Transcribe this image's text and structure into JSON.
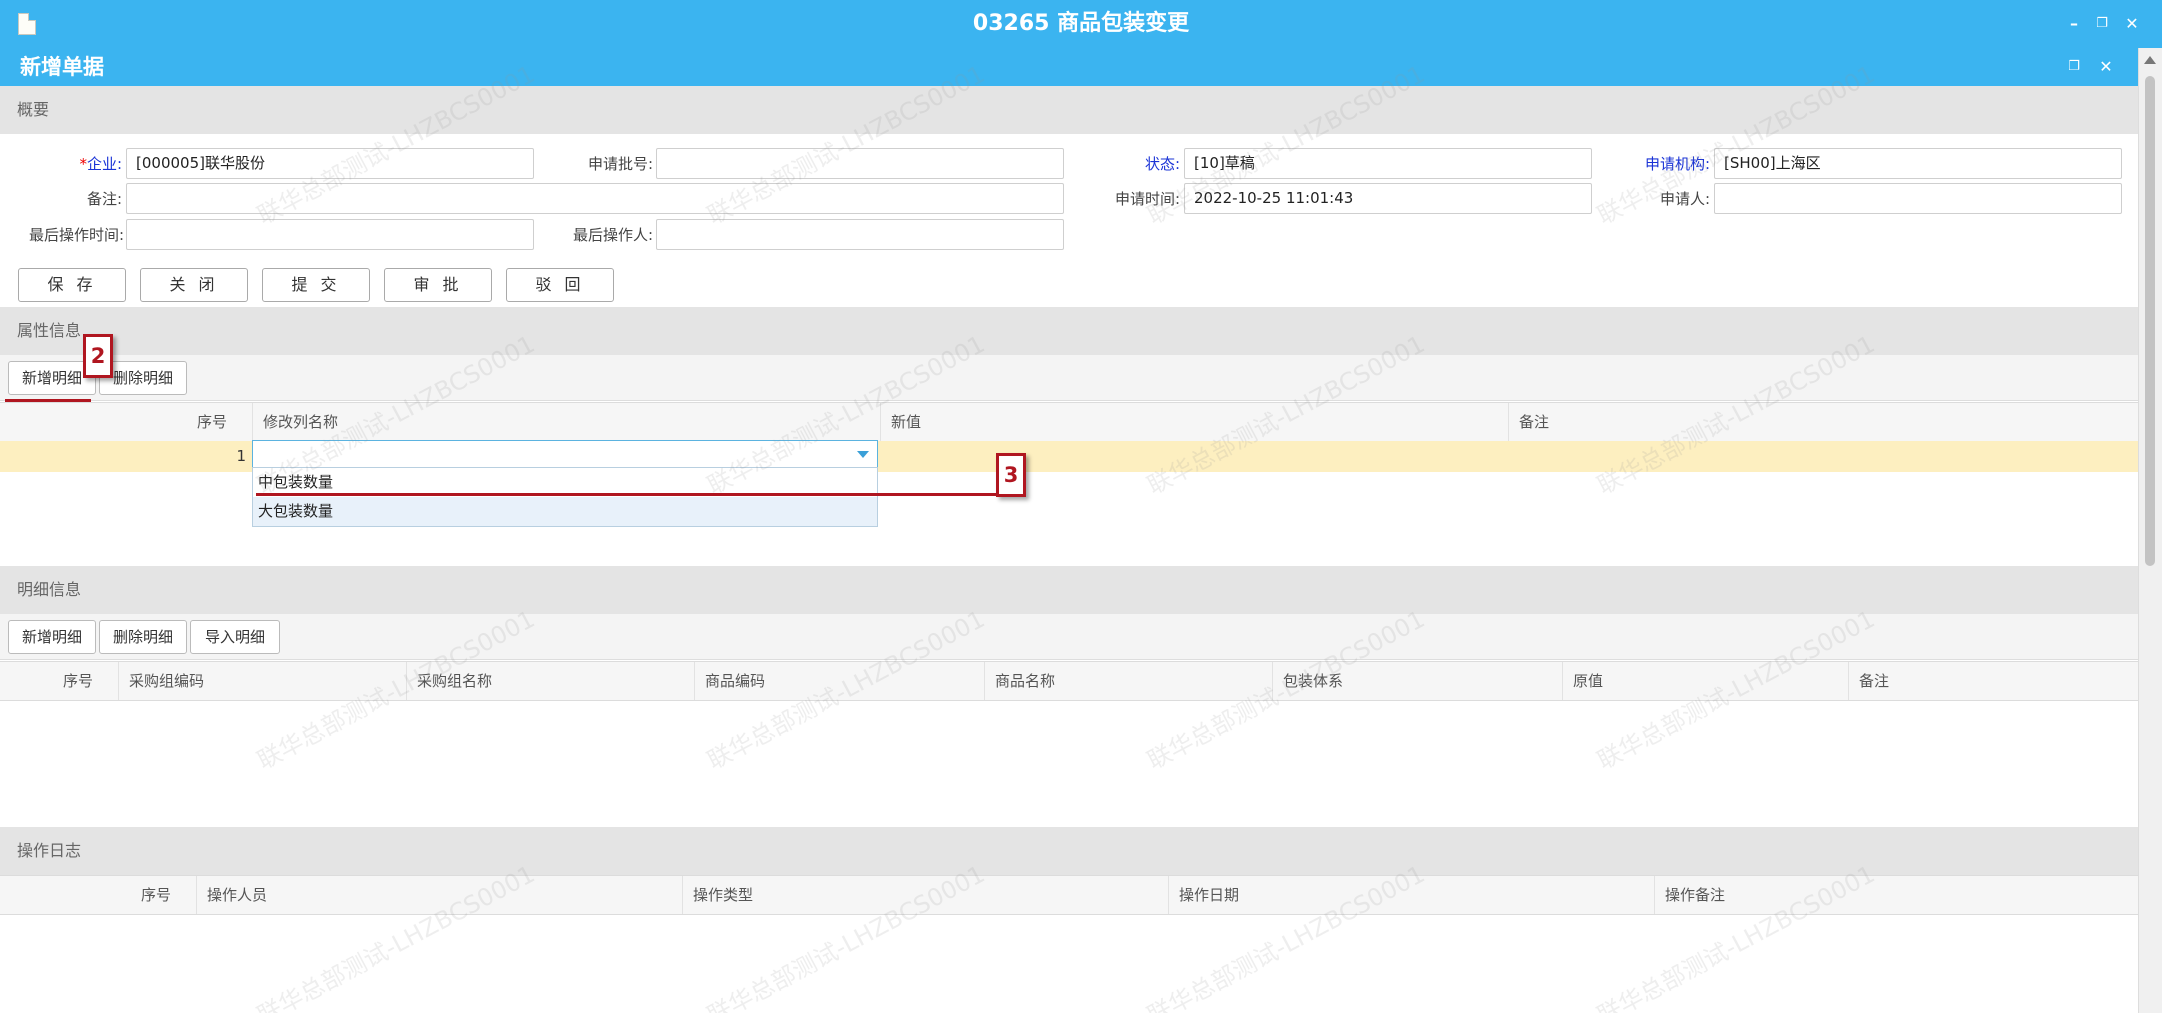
{
  "window": {
    "title": "03265 商品包装变更",
    "subtitle": "新增单据"
  },
  "summary": {
    "header": "概要",
    "fields": {
      "enterprise_label": "企业:",
      "enterprise_req": "*",
      "enterprise_value": "[000005]联华股份",
      "batch_no_label": "申请批号:",
      "batch_no_value": "",
      "status_label": "状态:",
      "status_value": "[10]草稿",
      "org_label": "申请机构:",
      "org_value": "[SH00]上海区",
      "remark_label": "备注:",
      "remark_value": "",
      "apply_time_label": "申请时间:",
      "apply_time_value": "2022-10-25 11:01:43",
      "applicant_label": "申请人:",
      "applicant_value": "",
      "last_op_time_label": "最后操作时间:",
      "last_op_time_value": "",
      "last_operator_label": "最后操作人:",
      "last_operator_value": ""
    },
    "buttons": [
      "保 存",
      "关 闭",
      "提 交",
      "审 批",
      "驳 回"
    ]
  },
  "attributes": {
    "header": "属性信息",
    "buttons": [
      "新增明细",
      "删除明细"
    ],
    "columns": [
      "序号",
      "修改列名称",
      "新值",
      "备注"
    ],
    "rows": [
      {
        "seq": "1",
        "column_name": "",
        "new_value": "",
        "remark": ""
      }
    ],
    "dropdown_options": [
      "中包装数量",
      "大包装数量"
    ]
  },
  "details": {
    "header": "明细信息",
    "buttons": [
      "新增明细",
      "删除明细",
      "导入明细"
    ],
    "columns": [
      "序号",
      "采购组编码",
      "采购组名称",
      "商品编码",
      "商品名称",
      "包装体系",
      "原值",
      "备注"
    ]
  },
  "oplog": {
    "header": "操作日志",
    "columns": [
      "序号",
      "操作人员",
      "操作类型",
      "操作日期",
      "操作备注"
    ]
  },
  "annotations": {
    "callout_2": "2",
    "callout_3": "3"
  },
  "watermark": "联华总部测试-LHZBCS0001",
  "colors": {
    "titlebar": "#3bb4f0",
    "label_blue": "#1a33d6",
    "required": "#e00000",
    "selected_row": "#fdefc0",
    "annotation": "#b01620"
  }
}
